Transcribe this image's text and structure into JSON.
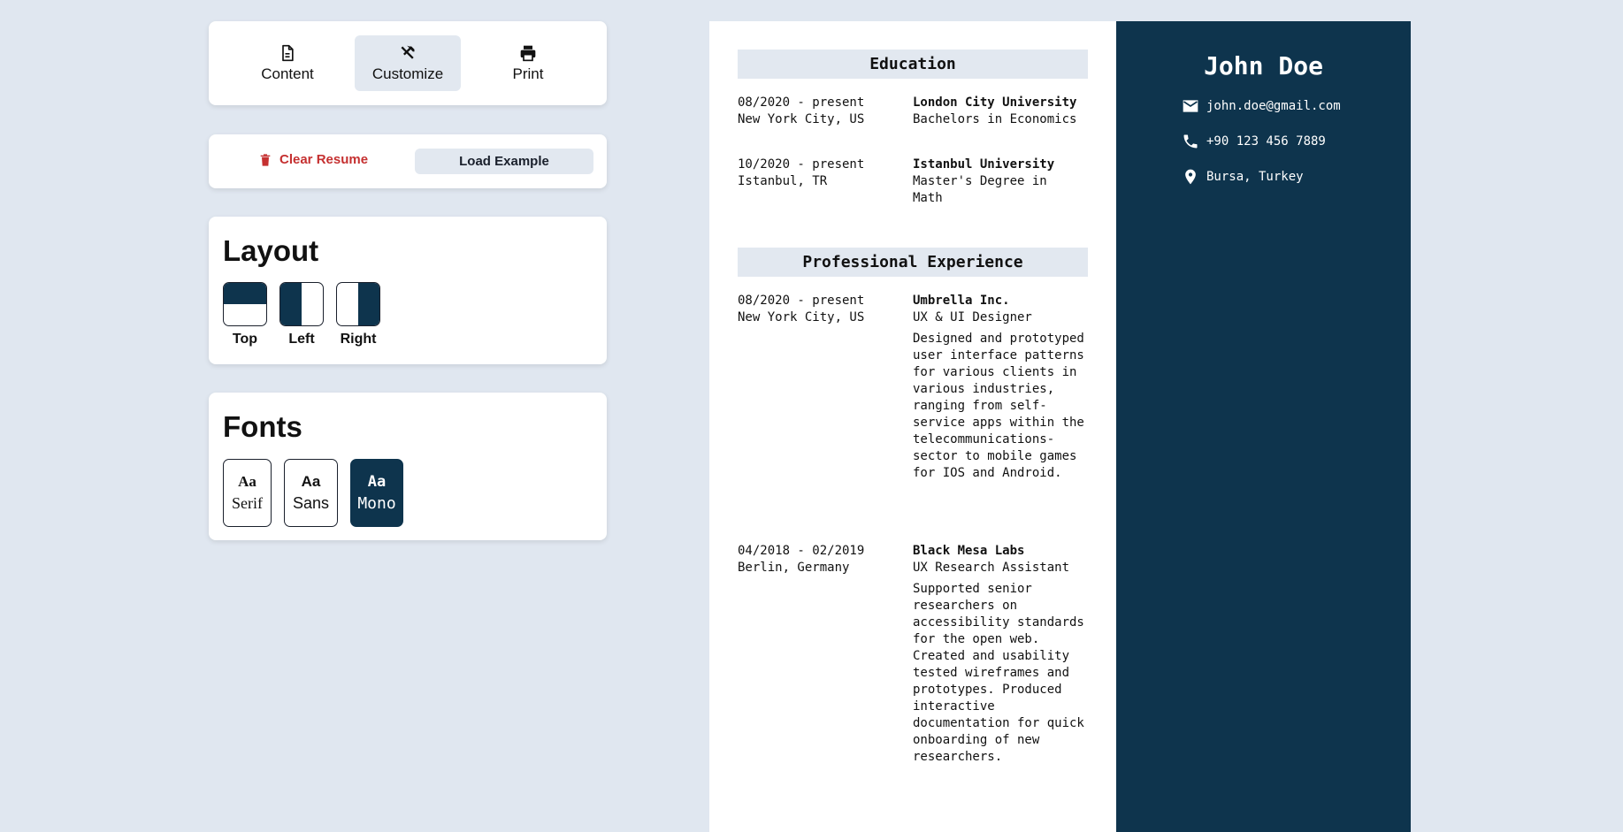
{
  "tabs": [
    {
      "label": "Content",
      "icon": "document-icon"
    },
    {
      "label": "Customize",
      "icon": "tools-icon"
    },
    {
      "label": "Print",
      "icon": "printer-icon"
    }
  ],
  "actions": {
    "clear_label": "Clear Resume",
    "load_label": "Load Example"
  },
  "layout": {
    "title": "Layout",
    "options": [
      {
        "label": "Top"
      },
      {
        "label": "Left"
      },
      {
        "label": "Right"
      }
    ],
    "selected": "Right"
  },
  "fonts": {
    "title": "Fonts",
    "options": [
      {
        "sample": "Aa",
        "label": "Serif"
      },
      {
        "sample": "Aa",
        "label": "Sans"
      },
      {
        "sample": "Aa",
        "label": "Mono"
      }
    ],
    "selected": "Mono"
  },
  "colors": {
    "accent": "#0e344d",
    "background": "#e0e7f0",
    "danger": "#c53030"
  },
  "resume": {
    "name": "John Doe",
    "contacts": {
      "email": "john.doe@gmail.com",
      "phone": "+90 123 456 7889",
      "location": "Bursa, Turkey"
    },
    "education": {
      "title": "Education",
      "entries": [
        {
          "date": "08/2020 - present",
          "place": "New York City, US",
          "school": "London City University",
          "degree": "Bachelors in Economics"
        },
        {
          "date": "10/2020 - present",
          "place": "Istanbul, TR",
          "school": "Istanbul University",
          "degree": "Master's Degree in Math"
        }
      ]
    },
    "experience": {
      "title": "Professional Experience",
      "entries": [
        {
          "date": "08/2020 - present",
          "place": "New York City, US",
          "company": "Umbrella Inc.",
          "role": "UX & UI Designer",
          "description": "Designed and prototyped user interface patterns for various clients in various industries, ranging from self-service apps within the telecommunications-sector to mobile games for IOS and Android."
        },
        {
          "date": "04/2018 - 02/2019",
          "place": "Berlin, Germany",
          "company": "Black Mesa Labs",
          "role": "UX Research Assistant",
          "description": "Supported senior researchers on accessibility standards for the open web. Created and usability tested wireframes and prototypes. Produced interactive documentation for quick onboarding of new researchers."
        }
      ]
    }
  }
}
